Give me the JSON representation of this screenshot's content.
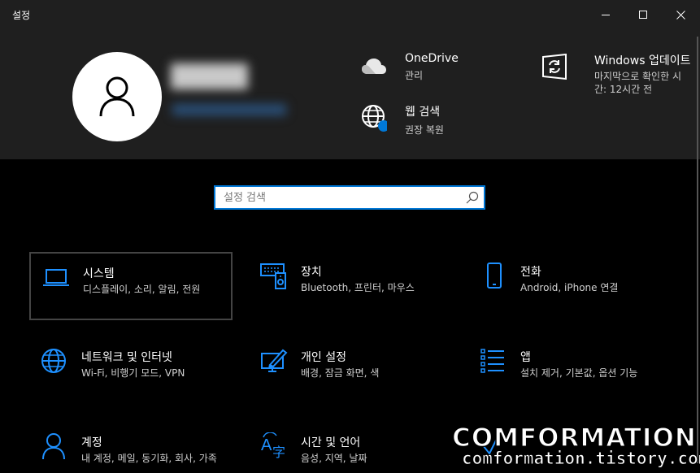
{
  "window": {
    "title": "설정"
  },
  "header": {
    "onedrive": {
      "title": "OneDrive",
      "subtitle": "관리"
    },
    "web_search": {
      "title": "웹 검색",
      "subtitle": "권장 복원"
    },
    "windows_update": {
      "title": "Windows 업데이트",
      "subtitle_line1": "마지막으로 확인한 시",
      "subtitle_line2": "간: 12시간 전"
    }
  },
  "search": {
    "placeholder": "설정 검색"
  },
  "tiles": [
    {
      "title": "시스템",
      "subtitle": "디스플레이, 소리, 알림, 전원",
      "icon": "laptop-icon"
    },
    {
      "title": "장치",
      "subtitle": "Bluetooth, 프린터, 마우스",
      "icon": "devices-icon"
    },
    {
      "title": "전화",
      "subtitle": "Android, iPhone 연결",
      "icon": "phone-icon"
    },
    {
      "title": "네트워크 및 인터넷",
      "subtitle": "Wi-Fi, 비행기 모드, VPN",
      "icon": "globe-icon"
    },
    {
      "title": "개인 설정",
      "subtitle": "배경, 잠금 화면, 색",
      "icon": "personalization-icon"
    },
    {
      "title": "앱",
      "subtitle": "설치 제거, 기본값, 옵션 기능",
      "icon": "apps-list-icon"
    },
    {
      "title": "계정",
      "subtitle": "내 계정, 메일, 동기화, 회사, 가족",
      "icon": "person-icon"
    },
    {
      "title": "시간 및 언어",
      "subtitle": "음성, 지역, 날짜",
      "icon": "time-language-icon"
    }
  ],
  "watermark": {
    "line1": "COMFORMATION",
    "line2": "comformation.tistory.com"
  },
  "colors": {
    "accent": "#0078d7",
    "icon": "#1e90ff",
    "header_bg": "#1f1f1f",
    "bg": "#000000"
  }
}
